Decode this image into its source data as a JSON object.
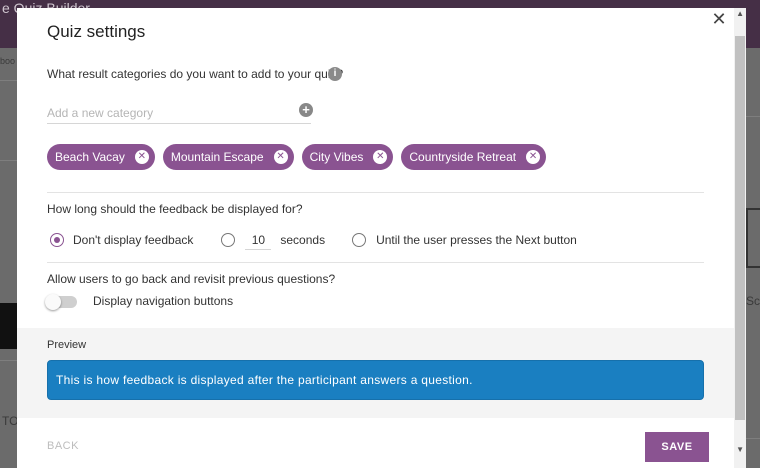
{
  "background": {
    "app_title": "e Quiz Builder",
    "fragment_left_1": "boo",
    "fragment_left_2": "TO",
    "fragment_right": "Sc"
  },
  "dialog": {
    "title": "Quiz settings",
    "close_icon": "close-icon",
    "categories": {
      "question": "What result categories do you want to add to your quiz?",
      "info_icon": "info-icon",
      "input_value": "",
      "input_placeholder": "Add a new category",
      "add_icon": "plus-circle-icon",
      "items": [
        {
          "label": "Beach Vacay"
        },
        {
          "label": "Mountain Escape"
        },
        {
          "label": "City Vibes"
        },
        {
          "label": "Countryside Retreat"
        }
      ]
    },
    "feedback": {
      "question": "How long should the feedback be displayed for?",
      "options": [
        {
          "label": "Don't display feedback",
          "checked": true
        },
        {
          "label": "seconds",
          "checked": false,
          "value": "10"
        },
        {
          "label": "Until the user presses the Next button",
          "checked": false
        }
      ]
    },
    "navigation": {
      "question": "Allow users to go back and revisit previous questions?",
      "toggle_label": "Display navigation buttons",
      "enabled": false
    },
    "preview": {
      "label": "Preview",
      "text": "This is how feedback is displayed after the participant answers a question."
    },
    "buttons": {
      "back": "BACK",
      "save": "SAVE"
    }
  },
  "colors": {
    "accent": "#8a5391",
    "preview_bg": "#1a7fc1"
  }
}
